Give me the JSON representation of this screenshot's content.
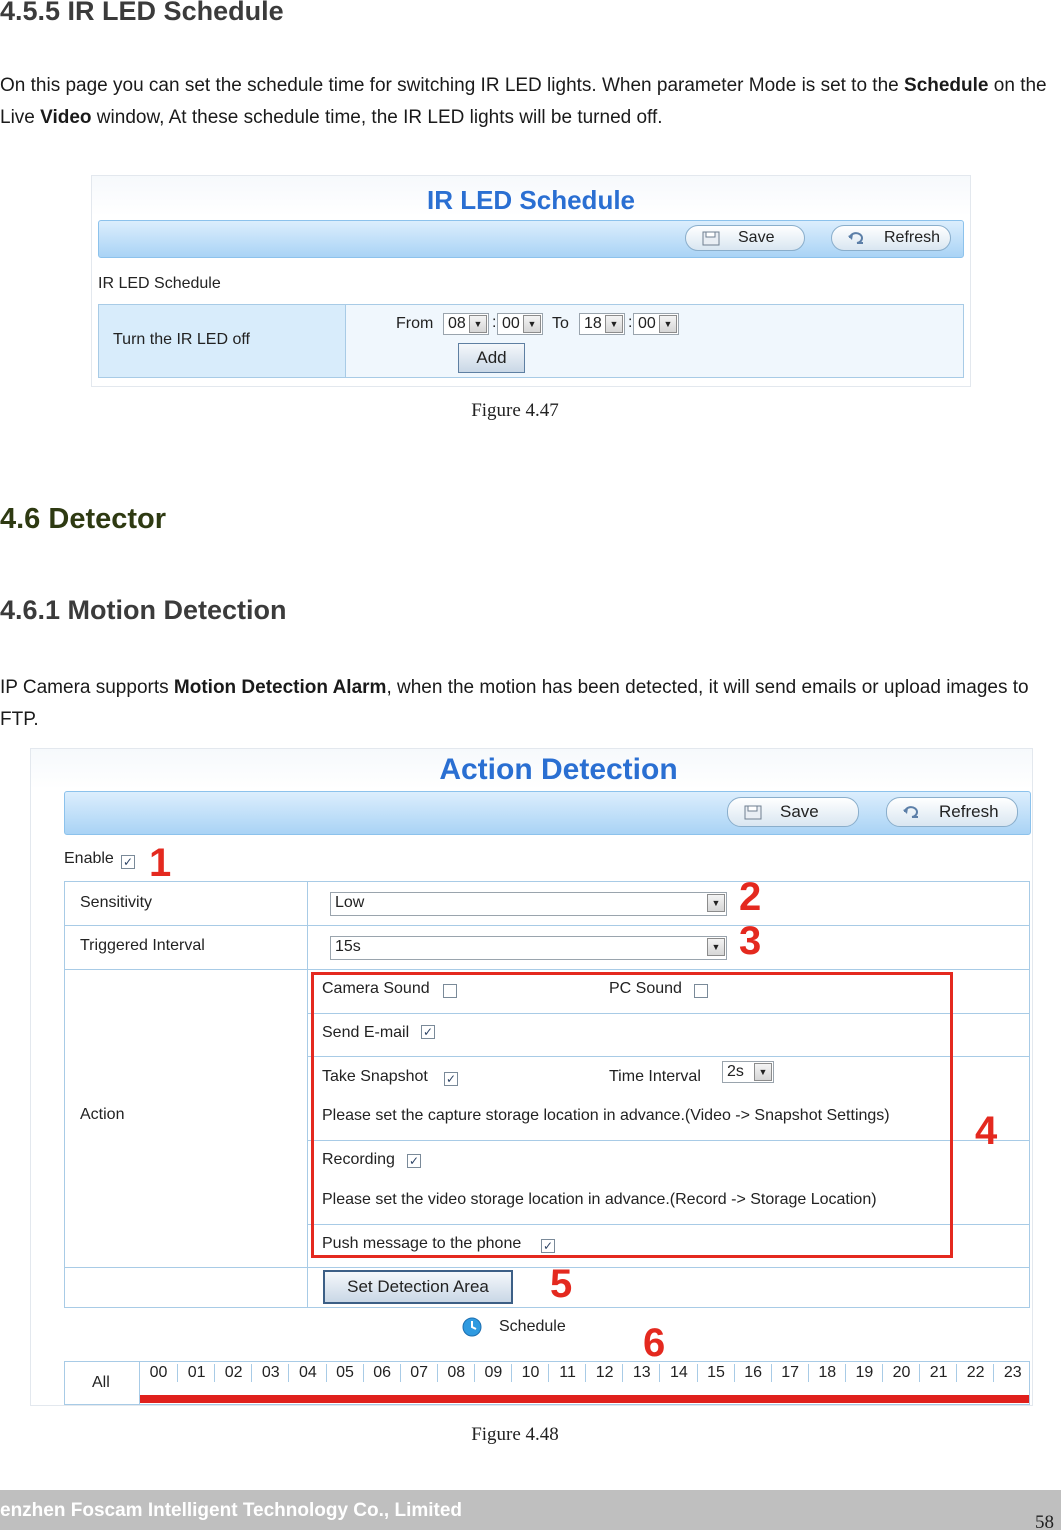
{
  "section_455": {
    "heading": "4.5.5 IR LED Schedule",
    "para_parts": [
      "On this page you can set the schedule time for switching IR LED lights. When parameter Mode is set to the ",
      "Schedule",
      " on the Live ",
      "Video",
      " window,    At these schedule time, the IR LED lights will be turned off."
    ]
  },
  "fig47": {
    "title": "IR LED Schedule",
    "save_label": "Save",
    "refresh_label": "Refresh",
    "section_label": "IR LED Schedule",
    "row_label": "Turn the IR LED off",
    "from_label": "From",
    "to_label": "To",
    "from_hour": "08",
    "from_min": "00",
    "to_hour": "18",
    "to_min": "00",
    "colon": ":",
    "add_label": "Add",
    "caption": "Figure 4.47"
  },
  "section_46": {
    "heading": "4.6 Detector"
  },
  "section_461": {
    "heading": "4.6.1 Motion Detection",
    "para_parts": [
      "IP Camera supports ",
      "Motion Detection Alarm",
      ", when the motion has been detected, it will send emails or upload images to FTP."
    ]
  },
  "fig48": {
    "title": "Action Detection",
    "save_label": "Save",
    "refresh_label": "Refresh",
    "enable_label": "Enable",
    "sensitivity_label": "Sensitivity",
    "sensitivity_value": "Low",
    "interval_label": "Triggered Interval",
    "interval_value": "15s",
    "action_label": "Action",
    "camera_sound": "Camera Sound",
    "pc_sound": "PC Sound",
    "send_email": "Send E-mail",
    "take_snapshot": "Take Snapshot",
    "time_interval": "Time Interval",
    "time_interval_value": "2s",
    "snapshot_note": "Please set the capture storage location in advance.(Video -> Snapshot Settings)",
    "recording": "Recording",
    "recording_note": "Please set the video storage location in advance.(Record -> Storage Location)",
    "push_message": "Push message to the phone",
    "set_area_label": "Set Detection Area",
    "schedule_label": "Schedule",
    "all_label": "All",
    "hours": [
      "00",
      "01",
      "02",
      "03",
      "04",
      "05",
      "06",
      "07",
      "08",
      "09",
      "10",
      "11",
      "12",
      "13",
      "14",
      "15",
      "16",
      "17",
      "18",
      "19",
      "20",
      "21",
      "22",
      "23"
    ],
    "markers": [
      "1",
      "2",
      "3",
      "4",
      "5",
      "6"
    ],
    "caption": "Figure 4.48"
  },
  "footer": {
    "company": "enzhen Foscam Intelligent Technology Co., Limited",
    "page_number": "58"
  },
  "colors": {
    "marker_red": "#e4291f",
    "accent_blue": "#2a6fd2",
    "schedule_bar": "#e0201c"
  }
}
